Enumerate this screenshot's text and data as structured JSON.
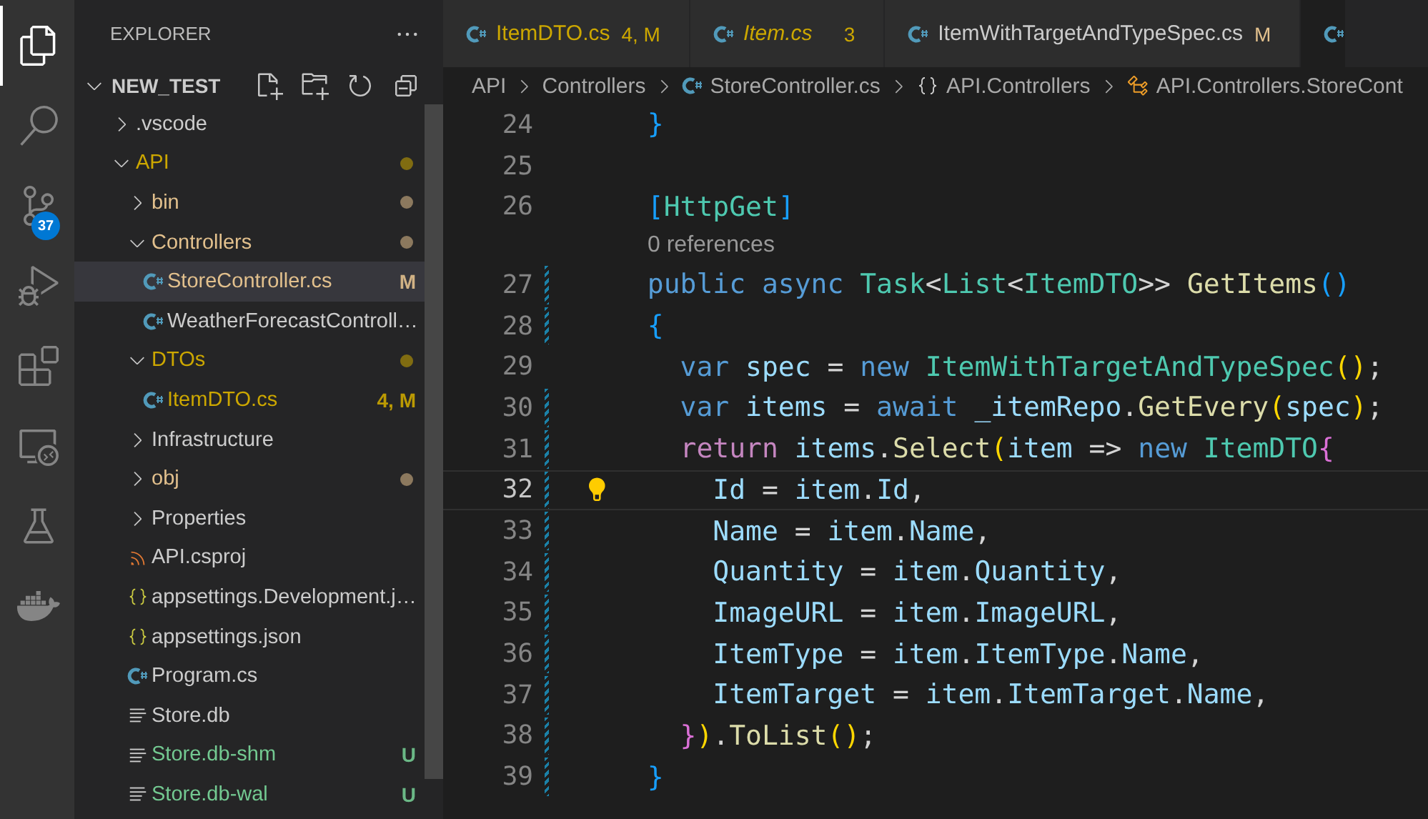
{
  "activity_bar": [
    {
      "kind": "files",
      "selected": true
    },
    {
      "kind": "search",
      "selected": false
    },
    {
      "kind": "source-control",
      "selected": false,
      "badge": "37"
    },
    {
      "kind": "run-debug",
      "selected": false
    },
    {
      "kind": "extensions",
      "selected": false
    },
    {
      "kind": "remote",
      "selected": false
    },
    {
      "kind": "testing",
      "selected": false
    },
    {
      "kind": "docker",
      "selected": false
    }
  ],
  "sidebar": {
    "title": "EXPLORER",
    "section": {
      "title": "NEW_TEST",
      "expanded": true
    },
    "tree": [
      {
        "label": ".vscode",
        "kind": "folder",
        "expanded": false,
        "color": "#cccccc",
        "dot": false,
        "selected": false
      },
      {
        "label": "API",
        "kind": "folder",
        "expanded": true,
        "color": "#cca700",
        "dot": true,
        "selected": false,
        "children": [
          {
            "label": "bin",
            "kind": "folder",
            "expanded": false,
            "color": "#e2c08d",
            "dot": true,
            "selected": false
          },
          {
            "label": "Controllers",
            "kind": "folder",
            "expanded": true,
            "color": "#e2c08d",
            "dot": true,
            "selected": false,
            "children": [
              {
                "label": "StoreController.cs",
                "kind": "csharp",
                "color": "#e2c08d",
                "badge": "M",
                "dot": false,
                "selected": true
              },
              {
                "label": "WeatherForecastControll…",
                "kind": "csharp",
                "color": "#cccccc",
                "dot": false,
                "selected": false
              }
            ]
          },
          {
            "label": "DTOs",
            "kind": "folder",
            "expanded": true,
            "color": "#cca700",
            "dot": true,
            "selected": false,
            "children": [
              {
                "label": "ItemDTO.cs",
                "kind": "csharp",
                "color": "#cca700",
                "badge": "4, M",
                "dot": false,
                "selected": false
              }
            ]
          },
          {
            "label": "Infrastructure",
            "kind": "folder",
            "expanded": false,
            "color": "#cccccc",
            "dot": false,
            "selected": false
          },
          {
            "label": "obj",
            "kind": "folder",
            "expanded": false,
            "color": "#e2c08d",
            "dot": true,
            "selected": false
          },
          {
            "label": "Properties",
            "kind": "folder",
            "expanded": false,
            "color": "#cccccc",
            "dot": false,
            "selected": false
          },
          {
            "label": "API.csproj",
            "kind": "rss",
            "color": "#cccccc",
            "dot": false,
            "selected": false
          },
          {
            "label": "appsettings.Development.j…",
            "kind": "json",
            "color": "#cccccc",
            "dot": false,
            "selected": false
          },
          {
            "label": "appsettings.json",
            "kind": "json",
            "color": "#cccccc",
            "dot": false,
            "selected": false
          },
          {
            "label": "Program.cs",
            "kind": "csharp",
            "color": "#cccccc",
            "dot": false,
            "selected": false
          },
          {
            "label": "Store.db",
            "kind": "text",
            "color": "#cccccc",
            "dot": false,
            "selected": false
          },
          {
            "label": "Store.db-shm",
            "kind": "text",
            "color": "#73c991",
            "badge": "U",
            "dot": false,
            "selected": false
          },
          {
            "label": "Store.db-wal",
            "kind": "text",
            "color": "#73c991",
            "badge": "U",
            "dot": false,
            "selected": false
          }
        ]
      }
    ]
  },
  "tabs": [
    {
      "label": "ItemDTO.cs",
      "badge": "4, M",
      "color": "#cca700",
      "problems": true,
      "preview": false,
      "selected": false
    },
    {
      "label": "Item.cs",
      "badge": "3",
      "color": "#cca700",
      "problems": true,
      "preview": true,
      "selected": false
    },
    {
      "label": "ItemWithTargetAndTypeSpec.cs",
      "badge": "M",
      "color": "#e2c08d",
      "problems": false,
      "preview": false,
      "selected": false
    },
    {
      "selected": true
    }
  ],
  "breadcrumbs": [
    {
      "label": "API",
      "kind": "folder"
    },
    {
      "label": "Controllers",
      "kind": "folder"
    },
    {
      "label": "StoreController.cs",
      "kind": "csharp"
    },
    {
      "label": "API.Controllers",
      "kind": "namespace"
    },
    {
      "label": "API.Controllers.StoreCont",
      "kind": "class"
    }
  ],
  "editor": {
    "lines": [
      {
        "kind": "code",
        "number": "24",
        "current": false,
        "changed": false,
        "lightbulb": false,
        "tokens": [
          {
            "t": "  }",
            "kind": "bracket3"
          }
        ]
      },
      {
        "kind": "code",
        "number": "25",
        "current": false,
        "changed": false,
        "lightbulb": false
      },
      {
        "kind": "code",
        "number": "26",
        "current": false,
        "changed": false,
        "lightbulb": false,
        "tokens": [
          {
            "t": "  [",
            "kind": "bracket3"
          },
          {
            "t": "HttpGet",
            "kind": "type"
          },
          {
            "t": "]",
            "kind": "bracket3"
          }
        ]
      },
      {
        "kind": "codelens",
        "text": "0 references"
      },
      {
        "kind": "code",
        "number": "27",
        "current": false,
        "changed": true,
        "lightbulb": false,
        "tokens": [
          {
            "t": "  public async ",
            "kind": "keyword"
          },
          {
            "t": "Task",
            "kind": "type"
          },
          {
            "t": "<",
            "kind": "plain"
          },
          {
            "t": "List",
            "kind": "type"
          },
          {
            "t": "<",
            "kind": "plain"
          },
          {
            "t": "ItemDTO",
            "kind": "type"
          },
          {
            "t": ">> ",
            "kind": "plain"
          },
          {
            "t": "GetItems",
            "kind": "method"
          },
          {
            "t": "()",
            "kind": "bracket3"
          }
        ]
      },
      {
        "kind": "code",
        "number": "28",
        "current": false,
        "changed": true,
        "lightbulb": false,
        "tokens": [
          {
            "t": "  {",
            "kind": "bracket3"
          }
        ]
      },
      {
        "kind": "code",
        "number": "29",
        "current": false,
        "changed": false,
        "lightbulb": false,
        "tokens": [
          {
            "t": "    var ",
            "kind": "keyword"
          },
          {
            "t": "spec",
            "kind": "variable"
          },
          {
            "t": " = ",
            "kind": "plain"
          },
          {
            "t": "new ",
            "kind": "keyword"
          },
          {
            "t": "ItemWithTargetAndTypeSpec",
            "kind": "type"
          },
          {
            "t": "()",
            "kind": "bracket1"
          },
          {
            "t": ";",
            "kind": "plain"
          }
        ]
      },
      {
        "kind": "code",
        "number": "30",
        "current": false,
        "changed": true,
        "lightbulb": false,
        "tokens": [
          {
            "t": "    var ",
            "kind": "keyword"
          },
          {
            "t": "items",
            "kind": "variable"
          },
          {
            "t": " = ",
            "kind": "plain"
          },
          {
            "t": "await ",
            "kind": "keyword"
          },
          {
            "t": "_itemRepo",
            "kind": "variable"
          },
          {
            "t": ".",
            "kind": "plain"
          },
          {
            "t": "GetEvery",
            "kind": "method"
          },
          {
            "t": "(",
            "kind": "bracket1"
          },
          {
            "t": "spec",
            "kind": "variable"
          },
          {
            "t": ")",
            "kind": "bracket1"
          },
          {
            "t": ";",
            "kind": "plain"
          }
        ]
      },
      {
        "kind": "code",
        "number": "31",
        "current": false,
        "changed": true,
        "lightbulb": false,
        "tokens": [
          {
            "t": "    return ",
            "kind": "control"
          },
          {
            "t": "items",
            "kind": "variable"
          },
          {
            "t": ".",
            "kind": "plain"
          },
          {
            "t": "Select",
            "kind": "method"
          },
          {
            "t": "(",
            "kind": "bracket1"
          },
          {
            "t": "item",
            "kind": "variable"
          },
          {
            "t": " => ",
            "kind": "plain"
          },
          {
            "t": "new ",
            "kind": "keyword"
          },
          {
            "t": "ItemDTO",
            "kind": "type"
          },
          {
            "t": "{",
            "kind": "bracket2"
          }
        ]
      },
      {
        "kind": "code",
        "number": "32",
        "current": true,
        "changed": true,
        "lightbulb": true,
        "tokens": [
          {
            "t": "      Id",
            "kind": "variable"
          },
          {
            "t": " = ",
            "kind": "plain"
          },
          {
            "t": "item",
            "kind": "variable"
          },
          {
            "t": ".",
            "kind": "plain"
          },
          {
            "t": "Id",
            "kind": "variable"
          },
          {
            "t": ",",
            "kind": "plain"
          }
        ]
      },
      {
        "kind": "code",
        "number": "33",
        "current": false,
        "changed": true,
        "lightbulb": false,
        "tokens": [
          {
            "t": "      Name",
            "kind": "variable"
          },
          {
            "t": " = ",
            "kind": "plain"
          },
          {
            "t": "item",
            "kind": "variable"
          },
          {
            "t": ".",
            "kind": "plain"
          },
          {
            "t": "Name",
            "kind": "variable"
          },
          {
            "t": ",",
            "kind": "plain"
          }
        ]
      },
      {
        "kind": "code",
        "number": "34",
        "current": false,
        "changed": true,
        "lightbulb": false,
        "tokens": [
          {
            "t": "      Quantity",
            "kind": "variable"
          },
          {
            "t": " = ",
            "kind": "plain"
          },
          {
            "t": "item",
            "kind": "variable"
          },
          {
            "t": ".",
            "kind": "plain"
          },
          {
            "t": "Quantity",
            "kind": "variable"
          },
          {
            "t": ",",
            "kind": "plain"
          }
        ]
      },
      {
        "kind": "code",
        "number": "35",
        "current": false,
        "changed": true,
        "lightbulb": false,
        "tokens": [
          {
            "t": "      ImageURL",
            "kind": "variable"
          },
          {
            "t": " = ",
            "kind": "plain"
          },
          {
            "t": "item",
            "kind": "variable"
          },
          {
            "t": ".",
            "kind": "plain"
          },
          {
            "t": "ImageURL",
            "kind": "variable"
          },
          {
            "t": ",",
            "kind": "plain"
          }
        ]
      },
      {
        "kind": "code",
        "number": "36",
        "current": false,
        "changed": true,
        "lightbulb": false,
        "tokens": [
          {
            "t": "      ItemType",
            "kind": "variable"
          },
          {
            "t": " = ",
            "kind": "plain"
          },
          {
            "t": "item",
            "kind": "variable"
          },
          {
            "t": ".",
            "kind": "plain"
          },
          {
            "t": "ItemType",
            "kind": "variable"
          },
          {
            "t": ".",
            "kind": "plain"
          },
          {
            "t": "Name",
            "kind": "variable"
          },
          {
            "t": ",",
            "kind": "plain"
          }
        ]
      },
      {
        "kind": "code",
        "number": "37",
        "current": false,
        "changed": true,
        "lightbulb": false,
        "tokens": [
          {
            "t": "      ItemTarget",
            "kind": "variable"
          },
          {
            "t": " = ",
            "kind": "plain"
          },
          {
            "t": "item",
            "kind": "variable"
          },
          {
            "t": ".",
            "kind": "plain"
          },
          {
            "t": "ItemTarget",
            "kind": "variable"
          },
          {
            "t": ".",
            "kind": "plain"
          },
          {
            "t": "Name",
            "kind": "variable"
          },
          {
            "t": ",",
            "kind": "plain"
          }
        ]
      },
      {
        "kind": "code",
        "number": "38",
        "current": false,
        "changed": true,
        "lightbulb": false,
        "tokens": [
          {
            "t": "    }",
            "kind": "bracket2"
          },
          {
            "t": ")",
            "kind": "bracket1"
          },
          {
            "t": ".",
            "kind": "plain"
          },
          {
            "t": "ToList",
            "kind": "method"
          },
          {
            "t": "()",
            "kind": "bracket1"
          },
          {
            "t": ";",
            "kind": "plain"
          }
        ]
      },
      {
        "kind": "code",
        "number": "39",
        "current": false,
        "changed": true,
        "lightbulb": false,
        "tokens": [
          {
            "t": "  }",
            "kind": "bracket3"
          }
        ]
      }
    ]
  }
}
